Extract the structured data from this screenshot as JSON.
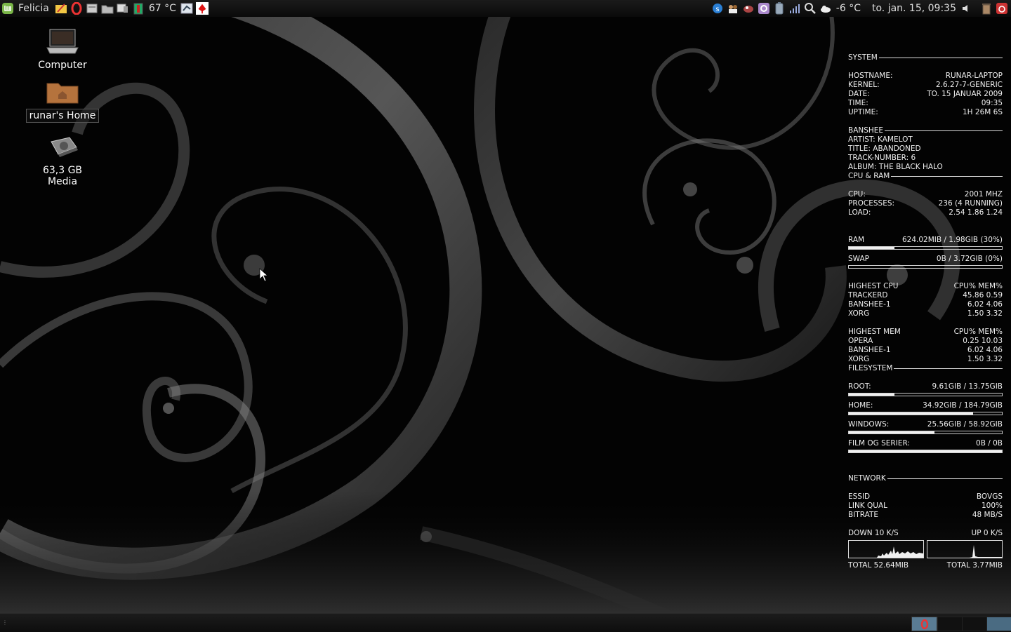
{
  "top_panel": {
    "menu_label": "Felicia",
    "temperature": "67 °C",
    "weather": "-6 °C",
    "clock": "to. jan. 15, 09:35"
  },
  "desktop": {
    "icons": [
      {
        "label": "Computer"
      },
      {
        "label": "runar's Home"
      },
      {
        "label": "63,3 GB Media"
      }
    ]
  },
  "conky": {
    "system": {
      "title": "SYSTEM",
      "rows": [
        {
          "k": "HOSTNAME:",
          "v": "RUNAR-LAPTOP"
        },
        {
          "k": "KERNEL:",
          "v": "2.6.27-7-GENERIC"
        },
        {
          "k": "DATE:",
          "v": "TO. 15 JANUAR 2009"
        },
        {
          "k": "TIME:",
          "v": "09:35"
        },
        {
          "k": "UPTIME:",
          "v": "1H 26M 6S"
        }
      ]
    },
    "banshee": {
      "title": "BANSHEE",
      "lines": [
        "ARTIST: KAMELOT",
        "TITLE: ABANDONED",
        "TRACK-NUMBER: 6",
        "ALBUM: THE BLACK HALO"
      ]
    },
    "cpu_ram": {
      "title": "CPU & RAM",
      "rows": [
        {
          "k": "CPU:",
          "v": "2001 MHZ"
        },
        {
          "k": "PROCESSES:",
          "v": "236 (4 RUNNING)"
        },
        {
          "k": "LOAD:",
          "v": "2.54 1.86 1.24"
        }
      ],
      "ram_label": "RAM",
      "ram_value": "624.02MIB / 1.98GIB (30%)",
      "ram_fraction": 0.3,
      "swap_label": "SWAP",
      "swap_value": "0B / 3.72GIB (0%)",
      "swap_fraction": 0.0
    },
    "highest_cpu": {
      "title": "HIGHEST CPU",
      "cols": "CPU% MEM%",
      "rows": [
        {
          "k": "TRACKERD",
          "v": "45.86  0.59"
        },
        {
          "k": "BANSHEE-1",
          "v": "6.02  4.06"
        },
        {
          "k": "XORG",
          "v": "1.50  3.32"
        }
      ]
    },
    "highest_mem": {
      "title": "HIGHEST MEM",
      "cols": "CPU% MEM%",
      "rows": [
        {
          "k": "OPERA",
          "v": "0.25 10.03"
        },
        {
          "k": "BANSHEE-1",
          "v": "6.02  4.06"
        },
        {
          "k": "XORG",
          "v": "1.50  3.32"
        }
      ]
    },
    "filesystem": {
      "title": "FILESYSTEM",
      "items": [
        {
          "k": "ROOT:",
          "v": "9.61GIB / 13.75GIB",
          "fraction": 0.3
        },
        {
          "k": "HOME:",
          "v": "34.92GIB / 184.79GIB",
          "fraction": 0.81
        },
        {
          "k": "WINDOWS:",
          "v": "25.56GIB / 58.92GIB",
          "fraction": 0.56
        },
        {
          "k": "FILM OG SERIER:",
          "v": "0B / 0B",
          "fraction": 1.0
        }
      ]
    },
    "network": {
      "title": "NETWORK",
      "rows": [
        {
          "k": "ESSID",
          "v": "BOVGS"
        },
        {
          "k": "LINK QUAL",
          "v": "100%"
        },
        {
          "k": "BITRATE",
          "v": "48 MB/S"
        }
      ],
      "down": "DOWN 10 K/S",
      "up": "UP 0 K/S",
      "total_down": "TOTAL 52.64MIB",
      "total_up": "TOTAL 3.77MIB"
    }
  },
  "colors": {
    "workspace_active": "#4a6b82",
    "panel": "#111111"
  }
}
